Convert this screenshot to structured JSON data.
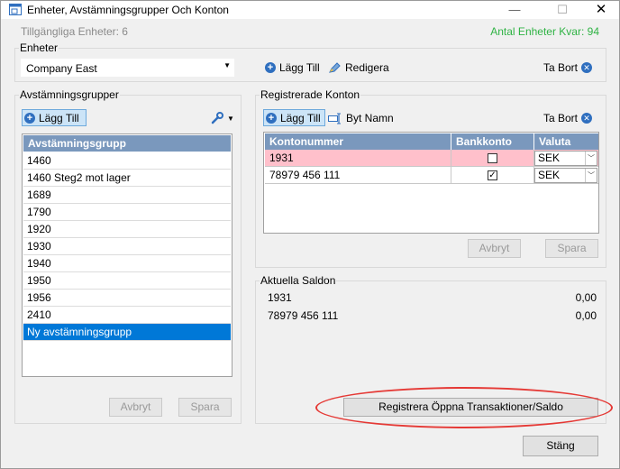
{
  "window": {
    "title": "Enheter, Avstämningsgrupper Och Konton",
    "minimize_glyph": "—",
    "maximize_glyph": "☐",
    "close_glyph": "✕"
  },
  "header": {
    "available_units": "Tillgängliga Enheter: 6",
    "units_left": "Antal Enheter Kvar: 94"
  },
  "enheter": {
    "label": "Enheter",
    "selected_unit": "Company East",
    "add_label": "Lägg Till",
    "edit_label": "Redigera",
    "delete_label": "Ta Bort"
  },
  "groups": {
    "label": "Avstämningsgrupper",
    "add_label": "Lägg Till",
    "column_header": "Avstämningsgrupp",
    "items": [
      "1460",
      "1460 Steg2 mot lager",
      "1689",
      "1790",
      "1920",
      "1930",
      "1940",
      "1950",
      "1956",
      "2410",
      "Ny avstämningsgrupp"
    ],
    "cancel_label": "Avbryt",
    "save_label": "Spara"
  },
  "accounts": {
    "label": "Registrerade Konton",
    "add_label": "Lägg Till",
    "rename_label": "Byt Namn",
    "delete_label": "Ta Bort",
    "columns": [
      "Kontonummer",
      "Bankkonto",
      "Valuta"
    ],
    "rows": [
      {
        "number": "1931",
        "bank": "☐",
        "currency": "SEK"
      },
      {
        "number": "78979 456 111",
        "bank": "☑",
        "currency": "SEK"
      }
    ],
    "cancel_label": "Avbryt",
    "save_label": "Spara"
  },
  "saldon": {
    "label": "Aktuella Saldon",
    "rows": [
      {
        "name": "1931",
        "amount": "0,00"
      },
      {
        "name": "78979 456 111",
        "amount": "0,00"
      }
    ]
  },
  "register_label": "Registrera Öppna Transaktioner/Saldo",
  "close_label": "Stäng",
  "colors": {
    "accent": "#0078d7",
    "header_blue": "#7a98bd",
    "pink_row": "#ffc0cb",
    "green_text": "#2fb344",
    "annotation_red": "#e53935"
  }
}
